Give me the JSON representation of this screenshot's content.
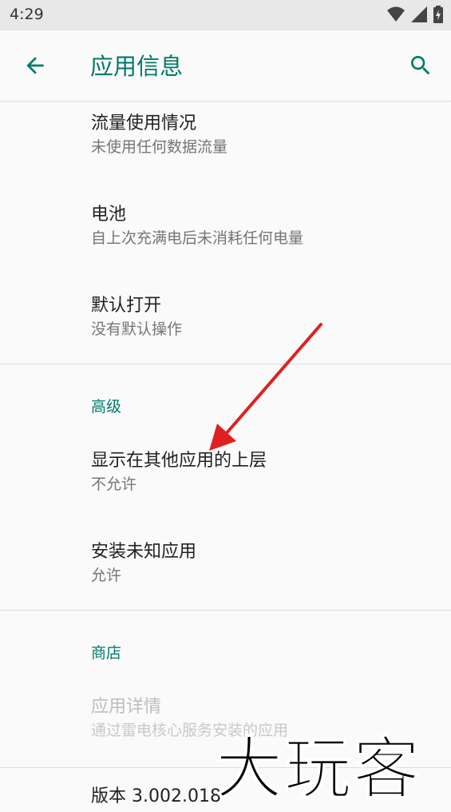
{
  "status_bar": {
    "time": "4:29"
  },
  "toolbar": {
    "title": "应用信息"
  },
  "items": [
    {
      "title": "流量使用情况",
      "summary": "未使用任何数据流量"
    },
    {
      "title": "电池",
      "summary": "自上次充满电后未消耗任何电量"
    },
    {
      "title": "默认打开",
      "summary": "没有默认操作"
    }
  ],
  "advanced": {
    "header": "高级",
    "items": [
      {
        "title": "显示在其他应用的上层",
        "summary": "不允许"
      },
      {
        "title": "安装未知应用",
        "summary": "允许"
      }
    ]
  },
  "store": {
    "header": "商店",
    "items": [
      {
        "title": "应用详情",
        "summary": "通过雷电核心服务安装的应用"
      }
    ]
  },
  "version": "版本 3.002.018",
  "watermark": "大玩客",
  "colors": {
    "accent": "#00796b",
    "arrow": "#e02020"
  }
}
